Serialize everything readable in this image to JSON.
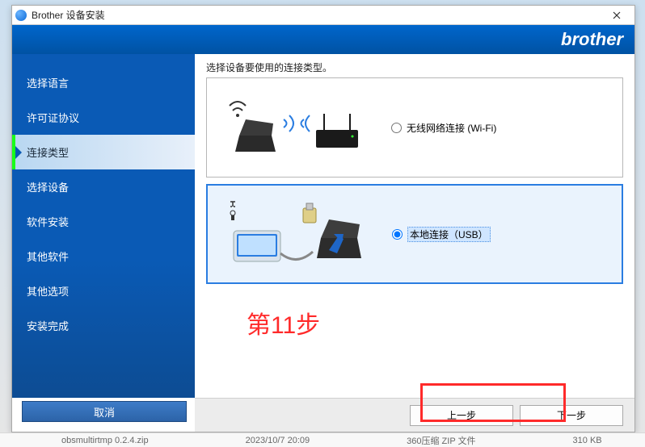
{
  "window": {
    "title": "Brother 设备安装"
  },
  "brand": "brother",
  "sidebar": {
    "items": [
      {
        "label": "选择语言"
      },
      {
        "label": "许可证协议"
      },
      {
        "label": "连接类型"
      },
      {
        "label": "选择设备"
      },
      {
        "label": "软件安装"
      },
      {
        "label": "其他软件"
      },
      {
        "label": "其他选项"
      },
      {
        "label": "安装完成"
      }
    ],
    "active_index": 2,
    "cancel": "取消"
  },
  "content": {
    "prompt": "选择设备要使用的连接类型。",
    "option_wifi": "无线网络连接 (Wi-Fi)",
    "option_usb": "本地连接（USB）",
    "selected": "usb"
  },
  "annotation": {
    "step_label": "第11步"
  },
  "footer": {
    "back": "上一步",
    "next": "下一步"
  },
  "taskbar": {
    "file": "obsmultirtmp 0.2.4.zip",
    "date": "2023/10/7 20:09",
    "type": "360压缩 ZIP 文件",
    "size": "310 KB"
  }
}
